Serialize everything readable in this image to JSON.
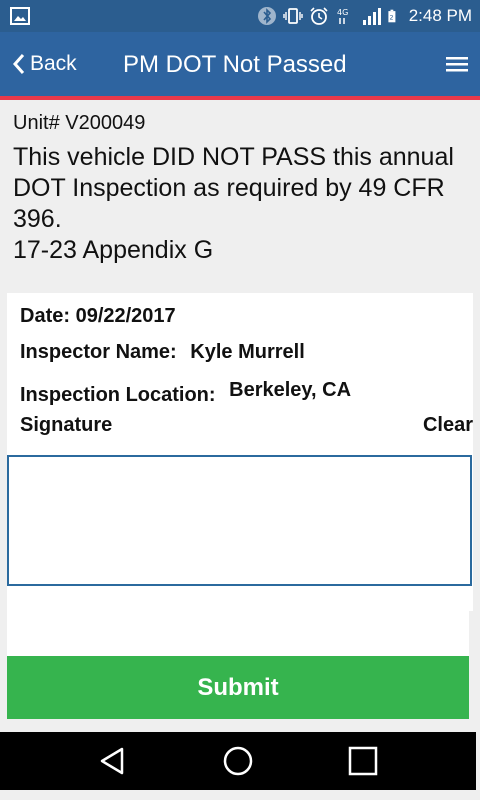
{
  "status_bar": {
    "time": "2:48 PM",
    "icons": [
      "image-icon",
      "bluetooth-icon",
      "vibrate-icon",
      "alarm-icon",
      "network-4g-icon",
      "signal-icon",
      "battery-icon"
    ],
    "background": "#2b5d8f"
  },
  "app_bar": {
    "back_label": "Back",
    "title": "PM DOT Not Passed",
    "background": "#2e64a0",
    "accent_line": "#e8394a"
  },
  "intro": {
    "unit": "Unit# V200049",
    "notice": "This vehicle DID NOT PASS this annual DOT Inspection as required by 49 CFR 396.",
    "appendix": "17-23 Appendix G"
  },
  "form": {
    "date": "Date: 09/22/2017",
    "inspector_label": "Inspector Name:",
    "inspector_value": "Kyle Murrell",
    "location_label": "Inspection Location:",
    "location_value": "Berkeley, CA",
    "signature_label": "Signature",
    "clear_label": "Clear"
  },
  "submit": {
    "label": "Submit",
    "color": "#36b44e"
  },
  "nav": {
    "buttons": [
      "back-nav-icon",
      "home-nav-icon",
      "recents-nav-icon"
    ]
  }
}
